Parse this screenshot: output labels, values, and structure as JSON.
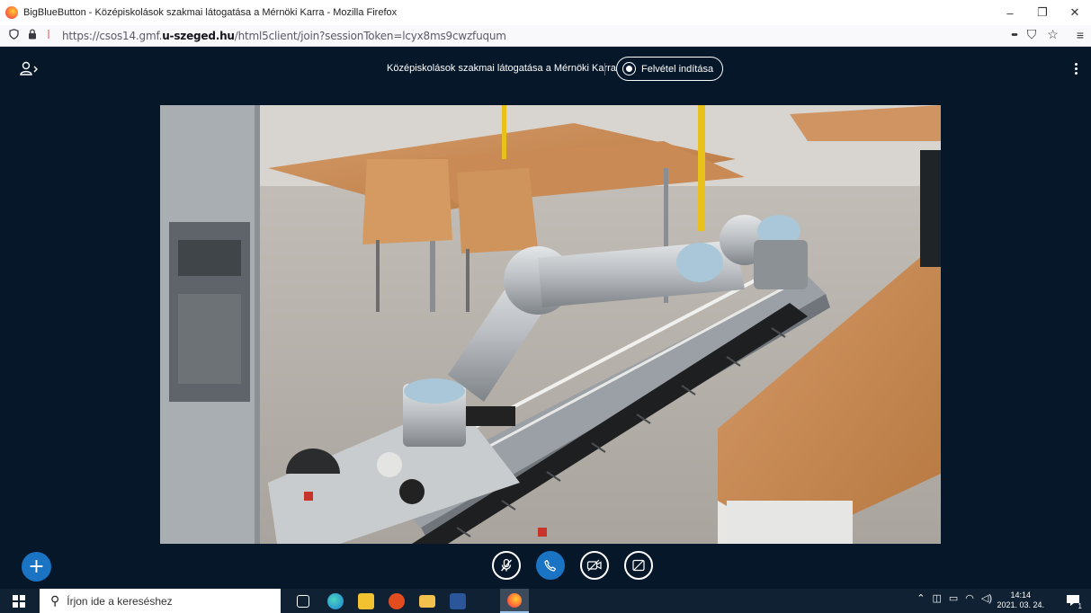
{
  "window": {
    "title": "BigBlueButton - Középiskolások szakmai látogatása a Mérnöki Karra - Mozilla Firefox",
    "minimize": "–",
    "restore": "❐",
    "close": "✕"
  },
  "urlbar": {
    "url_prefix": "https://csos14.gmf.",
    "url_domain": "u-szeged.hu",
    "url_path": "/html5client/join?sessionToken=lcyx8ms9cwzfuqum",
    "more": "•••",
    "pocket": "⛉",
    "bookmark": "☆",
    "menu": "≡"
  },
  "header": {
    "meeting_title": "Középiskolások szakmai látogatása a Mérnöki Karra",
    "record_label": "Felvétel indítása"
  },
  "actions": {
    "plus": "+"
  },
  "taskbar": {
    "search_placeholder": "Írjon ide a kereséshez",
    "time": "14:14",
    "date": "2021. 03. 24.",
    "notification_count": "1"
  },
  "colors": {
    "bbb_bg": "#06172a",
    "accent": "#1b73c4",
    "taskbar": "#0f2132"
  }
}
